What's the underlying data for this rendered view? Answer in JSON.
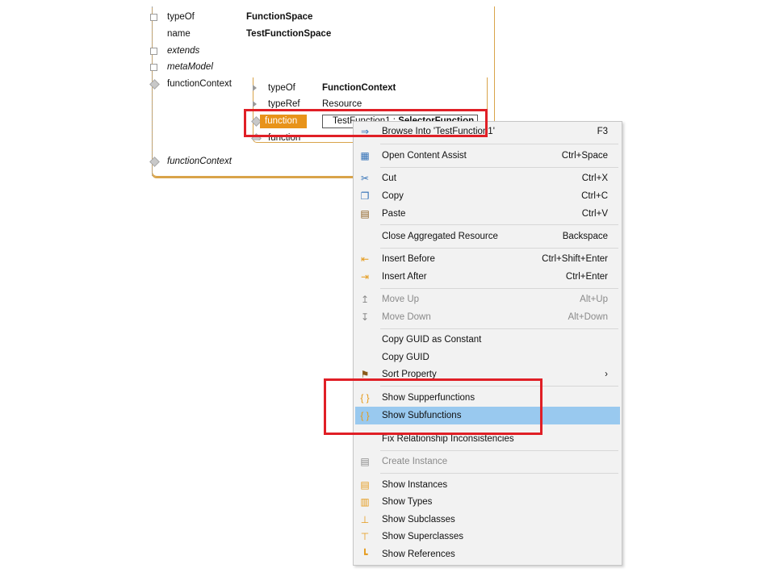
{
  "editor": {
    "outer_rows": [
      {
        "name": "typeOf",
        "value": "FunctionSpace",
        "italic": false
      },
      {
        "name": "name",
        "value": "TestFunctionSpace",
        "italic": false
      },
      {
        "name": "extends",
        "value": "",
        "italic": true
      },
      {
        "name": "metaModel",
        "value": "",
        "italic": true
      },
      {
        "name": "functionContext",
        "value": "",
        "italic": false
      }
    ],
    "inner_rows": [
      {
        "name": "typeOf",
        "value": "FunctionContext"
      },
      {
        "name": "typeRef",
        "value": "Resource"
      }
    ],
    "function_label": "function",
    "function_value_prefix": "TestFunction1 : ",
    "function_value_type": "SelectorFunction",
    "function_below_label": "function",
    "bottom_row": "functionContext"
  },
  "menu": {
    "items": [
      {
        "icon": "browse-into-icon",
        "glyph": "⇒",
        "label": "Browse Into 'TestFunction1'",
        "shortcut": "F3"
      },
      {
        "icon": "content-assist-icon",
        "glyph": "▦",
        "label": "Open Content Assist",
        "shortcut": "Ctrl+Space"
      },
      {
        "icon": "cut-icon",
        "glyph": "✂",
        "label": "Cut",
        "shortcut": "Ctrl+X"
      },
      {
        "icon": "copy-icon",
        "glyph": "❐",
        "label": "Copy",
        "shortcut": "Ctrl+C"
      },
      {
        "icon": "paste-icon",
        "glyph": "▤",
        "label": "Paste",
        "shortcut": "Ctrl+V"
      },
      {
        "icon": "",
        "glyph": "",
        "label": "Close Aggregated Resource",
        "shortcut": "Backspace"
      },
      {
        "icon": "insert-before-icon",
        "glyph": "⇤",
        "label": "Insert Before",
        "shortcut": "Ctrl+Shift+Enter"
      },
      {
        "icon": "insert-after-icon",
        "glyph": "⇥",
        "label": "Insert After",
        "shortcut": "Ctrl+Enter"
      },
      {
        "icon": "move-up-icon",
        "glyph": "↥",
        "label": "Move Up",
        "shortcut": "Alt+Up"
      },
      {
        "icon": "move-down-icon",
        "glyph": "↧",
        "label": "Move Down",
        "shortcut": "Alt+Down"
      },
      {
        "icon": "",
        "glyph": "",
        "label": "Copy GUID as Constant",
        "shortcut": ""
      },
      {
        "icon": "",
        "glyph": "",
        "label": "Copy GUID",
        "shortcut": ""
      },
      {
        "icon": "sort-property-icon",
        "glyph": "⚑",
        "label": "Sort Property",
        "shortcut": "›"
      },
      {
        "icon": "braces-icon",
        "glyph": "{ }",
        "label": "Show Supperfunctions",
        "shortcut": ""
      },
      {
        "icon": "braces-icon",
        "glyph": "{ }",
        "label": "Show Subfunctions",
        "shortcut": ""
      },
      {
        "icon": "",
        "glyph": "",
        "label": "Fix Relationship Inconsistencies",
        "shortcut": ""
      },
      {
        "icon": "create-instance-icon",
        "glyph": "▤",
        "label": "Create Instance",
        "shortcut": ""
      },
      {
        "icon": "show-instances-icon",
        "glyph": "▤",
        "label": "Show Instances",
        "shortcut": ""
      },
      {
        "icon": "show-types-icon",
        "glyph": "▥",
        "label": "Show Types",
        "shortcut": ""
      },
      {
        "icon": "show-subclasses-icon",
        "glyph": "⊥",
        "label": "Show Subclasses",
        "shortcut": ""
      },
      {
        "icon": "show-superclasses-icon",
        "glyph": "⊤",
        "label": "Show Superclasses",
        "shortcut": ""
      },
      {
        "icon": "show-references-icon",
        "glyph": "┗",
        "label": "Show References",
        "shortcut": ""
      }
    ]
  }
}
